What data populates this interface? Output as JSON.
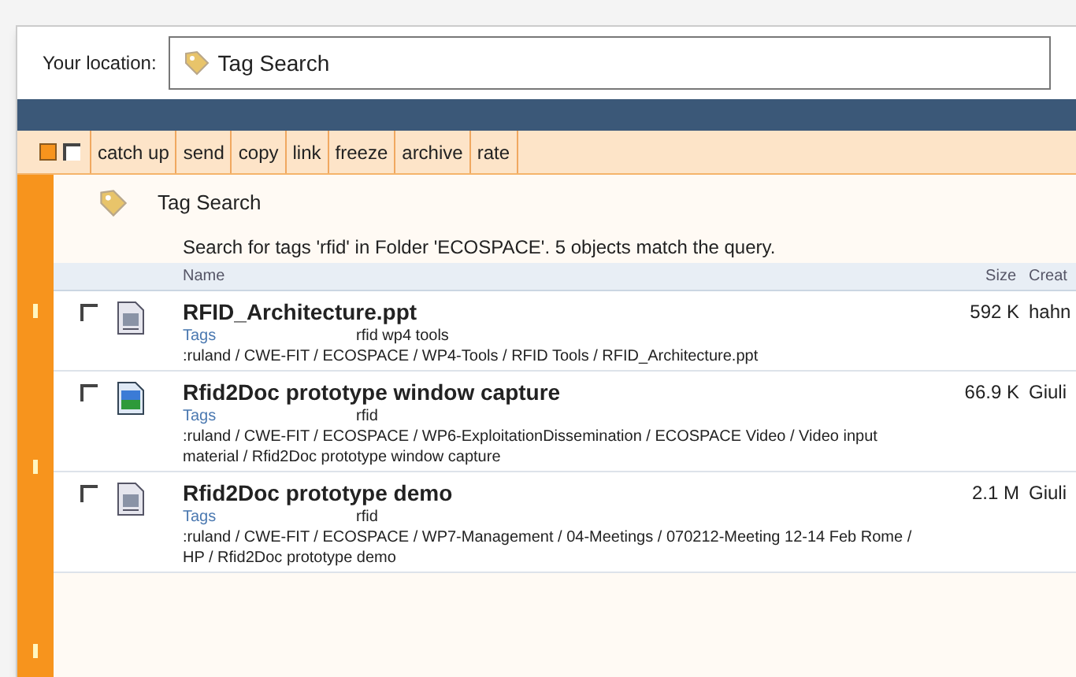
{
  "location": {
    "label": "Your location:",
    "value": "Tag Search"
  },
  "toolbar": {
    "checkboxes": [
      {
        "checked": true
      },
      {
        "checked": false
      }
    ],
    "actions": [
      "catch up",
      "send",
      "copy",
      "link",
      "freeze",
      "archive",
      "rate"
    ]
  },
  "heading": "Tag Search",
  "summary": "Search for tags 'rfid' in Folder 'ECOSPACE'. 5 objects match the query.",
  "table": {
    "columns": [
      "Name",
      "Size",
      "Creat"
    ],
    "rows": [
      {
        "kind": "presentation",
        "checked": false,
        "name": "RFID_Architecture.ppt",
        "size": "592 K",
        "creator": "hahn",
        "tags_label": "Tags",
        "tags": "rfid wp4 tools",
        "path": ":ruland / CWE-FIT / ECOSPACE / WP4-Tools / RFID Tools / RFID_Architecture.ppt"
      },
      {
        "kind": "image",
        "checked": false,
        "name": "Rfid2Doc prototype window capture",
        "size": "66.9 K",
        "creator": "Giuli",
        "tags_label": "Tags",
        "tags": "rfid",
        "path": ":ruland / CWE-FIT / ECOSPACE / WP6-ExploitationDissemination / ECOSPACE Video / Video input material / Rfid2Doc prototype window capture"
      },
      {
        "kind": "presentation",
        "checked": false,
        "name": "Rfid2Doc prototype demo",
        "size": "2.1 M",
        "creator": "Giuli",
        "tags_label": "Tags",
        "tags": "rfid",
        "path": ":ruland / CWE-FIT / ECOSPACE / WP7-Management / 04-Meetings / 070212-Meeting 12-14 Feb Rome / HP / Rfid2Doc prototype demo"
      }
    ]
  }
}
